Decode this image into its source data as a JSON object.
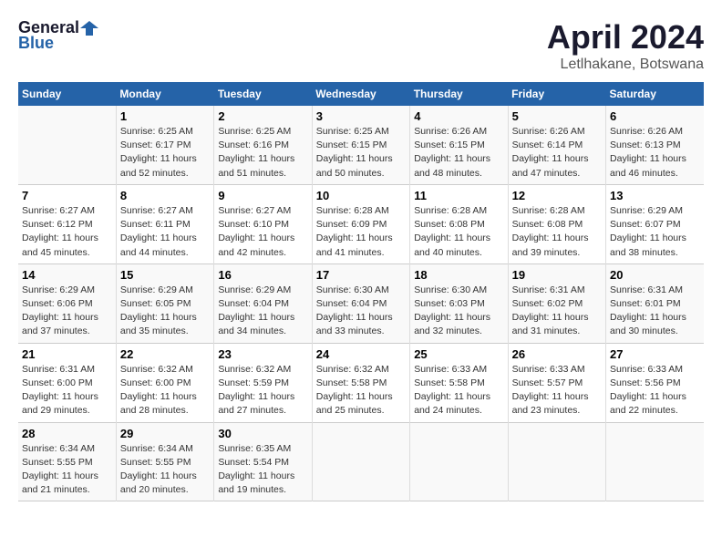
{
  "logo": {
    "general": "General",
    "blue": "Blue"
  },
  "title": "April 2024",
  "location": "Letlhakane, Botswana",
  "headers": [
    "Sunday",
    "Monday",
    "Tuesday",
    "Wednesday",
    "Thursday",
    "Friday",
    "Saturday"
  ],
  "weeks": [
    [
      {
        "day": "",
        "info": ""
      },
      {
        "day": "1",
        "info": "Sunrise: 6:25 AM\nSunset: 6:17 PM\nDaylight: 11 hours\nand 52 minutes."
      },
      {
        "day": "2",
        "info": "Sunrise: 6:25 AM\nSunset: 6:16 PM\nDaylight: 11 hours\nand 51 minutes."
      },
      {
        "day": "3",
        "info": "Sunrise: 6:25 AM\nSunset: 6:15 PM\nDaylight: 11 hours\nand 50 minutes."
      },
      {
        "day": "4",
        "info": "Sunrise: 6:26 AM\nSunset: 6:15 PM\nDaylight: 11 hours\nand 48 minutes."
      },
      {
        "day": "5",
        "info": "Sunrise: 6:26 AM\nSunset: 6:14 PM\nDaylight: 11 hours\nand 47 minutes."
      },
      {
        "day": "6",
        "info": "Sunrise: 6:26 AM\nSunset: 6:13 PM\nDaylight: 11 hours\nand 46 minutes."
      }
    ],
    [
      {
        "day": "7",
        "info": "Sunrise: 6:27 AM\nSunset: 6:12 PM\nDaylight: 11 hours\nand 45 minutes."
      },
      {
        "day": "8",
        "info": "Sunrise: 6:27 AM\nSunset: 6:11 PM\nDaylight: 11 hours\nand 44 minutes."
      },
      {
        "day": "9",
        "info": "Sunrise: 6:27 AM\nSunset: 6:10 PM\nDaylight: 11 hours\nand 42 minutes."
      },
      {
        "day": "10",
        "info": "Sunrise: 6:28 AM\nSunset: 6:09 PM\nDaylight: 11 hours\nand 41 minutes."
      },
      {
        "day": "11",
        "info": "Sunrise: 6:28 AM\nSunset: 6:08 PM\nDaylight: 11 hours\nand 40 minutes."
      },
      {
        "day": "12",
        "info": "Sunrise: 6:28 AM\nSunset: 6:08 PM\nDaylight: 11 hours\nand 39 minutes."
      },
      {
        "day": "13",
        "info": "Sunrise: 6:29 AM\nSunset: 6:07 PM\nDaylight: 11 hours\nand 38 minutes."
      }
    ],
    [
      {
        "day": "14",
        "info": "Sunrise: 6:29 AM\nSunset: 6:06 PM\nDaylight: 11 hours\nand 37 minutes."
      },
      {
        "day": "15",
        "info": "Sunrise: 6:29 AM\nSunset: 6:05 PM\nDaylight: 11 hours\nand 35 minutes."
      },
      {
        "day": "16",
        "info": "Sunrise: 6:29 AM\nSunset: 6:04 PM\nDaylight: 11 hours\nand 34 minutes."
      },
      {
        "day": "17",
        "info": "Sunrise: 6:30 AM\nSunset: 6:04 PM\nDaylight: 11 hours\nand 33 minutes."
      },
      {
        "day": "18",
        "info": "Sunrise: 6:30 AM\nSunset: 6:03 PM\nDaylight: 11 hours\nand 32 minutes."
      },
      {
        "day": "19",
        "info": "Sunrise: 6:31 AM\nSunset: 6:02 PM\nDaylight: 11 hours\nand 31 minutes."
      },
      {
        "day": "20",
        "info": "Sunrise: 6:31 AM\nSunset: 6:01 PM\nDaylight: 11 hours\nand 30 minutes."
      }
    ],
    [
      {
        "day": "21",
        "info": "Sunrise: 6:31 AM\nSunset: 6:00 PM\nDaylight: 11 hours\nand 29 minutes."
      },
      {
        "day": "22",
        "info": "Sunrise: 6:32 AM\nSunset: 6:00 PM\nDaylight: 11 hours\nand 28 minutes."
      },
      {
        "day": "23",
        "info": "Sunrise: 6:32 AM\nSunset: 5:59 PM\nDaylight: 11 hours\nand 27 minutes."
      },
      {
        "day": "24",
        "info": "Sunrise: 6:32 AM\nSunset: 5:58 PM\nDaylight: 11 hours\nand 25 minutes."
      },
      {
        "day": "25",
        "info": "Sunrise: 6:33 AM\nSunset: 5:58 PM\nDaylight: 11 hours\nand 24 minutes."
      },
      {
        "day": "26",
        "info": "Sunrise: 6:33 AM\nSunset: 5:57 PM\nDaylight: 11 hours\nand 23 minutes."
      },
      {
        "day": "27",
        "info": "Sunrise: 6:33 AM\nSunset: 5:56 PM\nDaylight: 11 hours\nand 22 minutes."
      }
    ],
    [
      {
        "day": "28",
        "info": "Sunrise: 6:34 AM\nSunset: 5:55 PM\nDaylight: 11 hours\nand 21 minutes."
      },
      {
        "day": "29",
        "info": "Sunrise: 6:34 AM\nSunset: 5:55 PM\nDaylight: 11 hours\nand 20 minutes."
      },
      {
        "day": "30",
        "info": "Sunrise: 6:35 AM\nSunset: 5:54 PM\nDaylight: 11 hours\nand 19 minutes."
      },
      {
        "day": "",
        "info": ""
      },
      {
        "day": "",
        "info": ""
      },
      {
        "day": "",
        "info": ""
      },
      {
        "day": "",
        "info": ""
      }
    ]
  ]
}
